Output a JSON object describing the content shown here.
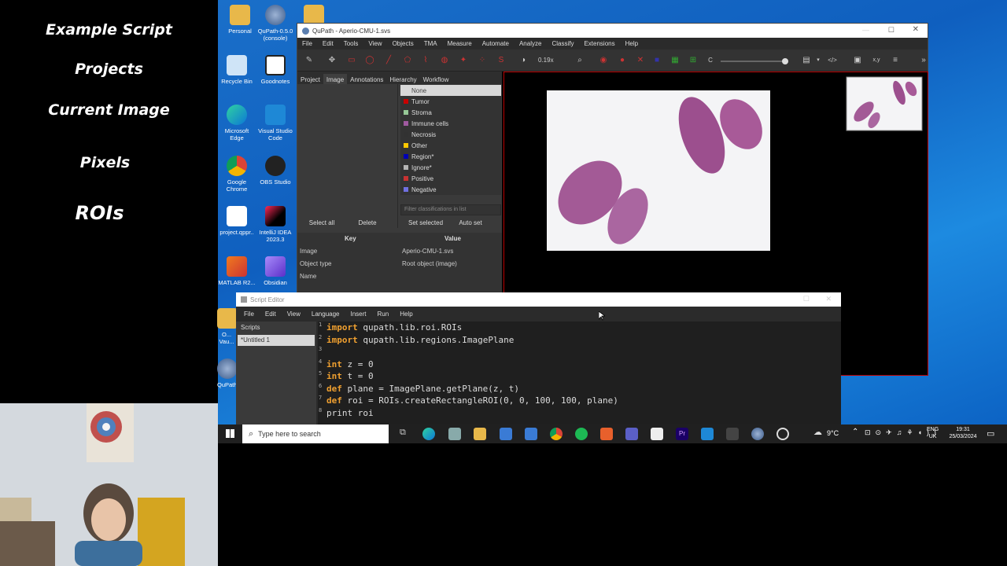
{
  "sidebar": {
    "items": [
      "Example Script",
      "Projects",
      "Current Image",
      "Pixels",
      "ROIs"
    ]
  },
  "desktop_icons": [
    "Personal",
    "QuPath-0.5.0 (console)",
    "",
    "Recycle Bin",
    "Goodnotes",
    "Microsoft Edge",
    "Visual Studio Code",
    "Google Chrome",
    "OBS Studio",
    "project.qppr..",
    "IntelliJ IDEA 2023.3",
    "MATLAB R2...",
    "Obsidian",
    "O... Vau...",
    "QuPath"
  ],
  "qupath": {
    "title": "QuPath - Aperio-CMU-1.svs",
    "menu": [
      "File",
      "Edit",
      "Tools",
      "View",
      "Objects",
      "TMA",
      "Measure",
      "Automate",
      "Analyze",
      "Classify",
      "Extensions",
      "Help"
    ],
    "zoom": "0.19x",
    "tool_c": "C",
    "tabs": [
      "Project",
      "Image",
      "Annotations",
      "Hierarchy",
      "Workflow"
    ],
    "classes": [
      {
        "name": "None",
        "color": "#dddddd"
      },
      {
        "name": "Tumor",
        "color": "#c80000"
      },
      {
        "name": "Stroma",
        "color": "#96c896"
      },
      {
        "name": "Immune cells",
        "color": "#a05aa0"
      },
      {
        "name": "Necrosis",
        "color": "#323232"
      },
      {
        "name": "Other",
        "color": "#ffc800"
      },
      {
        "name": "Region*",
        "color": "#0000b4"
      },
      {
        "name": "Ignore*",
        "color": "#b4b4b4"
      },
      {
        "name": "Positive",
        "color": "#c83232"
      },
      {
        "name": "Negative",
        "color": "#7070e0"
      }
    ],
    "filter_placeholder": "Filter classifications in list",
    "btn_select_all": "Select all",
    "btn_delete": "Delete",
    "btn_set_selected": "Set selected",
    "btn_auto_set": "Auto set",
    "table_headers": [
      "Key",
      "Value"
    ],
    "rows": [
      [
        "Image",
        "Aperio-CMU-1.svs"
      ],
      [
        "Object type",
        "Root object (image)"
      ],
      [
        "Name",
        ""
      ]
    ]
  },
  "script_editor": {
    "title": "Script Editor",
    "menu": [
      "File",
      "Edit",
      "View",
      "Language",
      "Insert",
      "Run",
      "Help"
    ],
    "scripts_label": "Scripts",
    "script_item": "*Untitled 1",
    "code": [
      {
        "n": "1",
        "kw": "import",
        "rest": " qupath.lib.roi.ROIs"
      },
      {
        "n": "2",
        "kw": "import",
        "rest": " qupath.lib.regions.ImagePlane"
      },
      {
        "n": "3",
        "kw": "",
        "rest": ""
      },
      {
        "n": "4",
        "kw": "int",
        "rest": " z = 0"
      },
      {
        "n": "5",
        "kw": "int",
        "rest": " t = 0"
      },
      {
        "n": "6",
        "kw": "def",
        "rest": " plane = ImagePlane.getPlane(z, t)"
      },
      {
        "n": "7",
        "kw": "def",
        "rest": " roi = ROIs.createRectangleROI(0, 0, 100, 100, plane)"
      },
      {
        "n": "8",
        "kw": "",
        "rest": "print roi"
      }
    ]
  },
  "taskbar": {
    "search_placeholder": "Type here to search",
    "weather": "9°C",
    "lang1": "ENG",
    "lang2": "UK",
    "time": "19:31",
    "date": "25/03/2024"
  }
}
